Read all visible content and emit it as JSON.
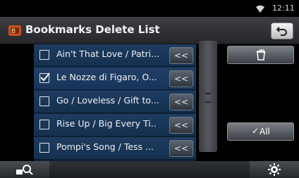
{
  "status": {
    "time": "12:11",
    "wifi_icon": "wifi-icon"
  },
  "header": {
    "title": "Bookmarks Delete List",
    "title_icon": "bookmark-icon",
    "back_icon": "back-arrow-icon"
  },
  "list": {
    "items": [
      {
        "label": "Ain't That Love / Patri...",
        "checked": false,
        "button_label": "<<"
      },
      {
        "label": "Le Nozze di Figaro, O...",
        "checked": true,
        "button_label": "<<"
      },
      {
        "label": "Go / Loveless / Gift to...",
        "checked": false,
        "button_label": "<<"
      },
      {
        "label": "Rise Up / Big Every Ti..",
        "checked": false,
        "button_label": "<<"
      },
      {
        "label": "Pompi's Song / Tess ...",
        "checked": false,
        "button_label": "<<"
      }
    ]
  },
  "actions": {
    "delete_icon": "trash-icon",
    "all_label": "All",
    "all_check": "✓"
  },
  "footer": {
    "search_icon": "search-icon",
    "settings_icon": "gear-icon"
  },
  "colors": {
    "row": "#1e3c60",
    "accent": "#4a8fd6",
    "background": "#000000"
  }
}
